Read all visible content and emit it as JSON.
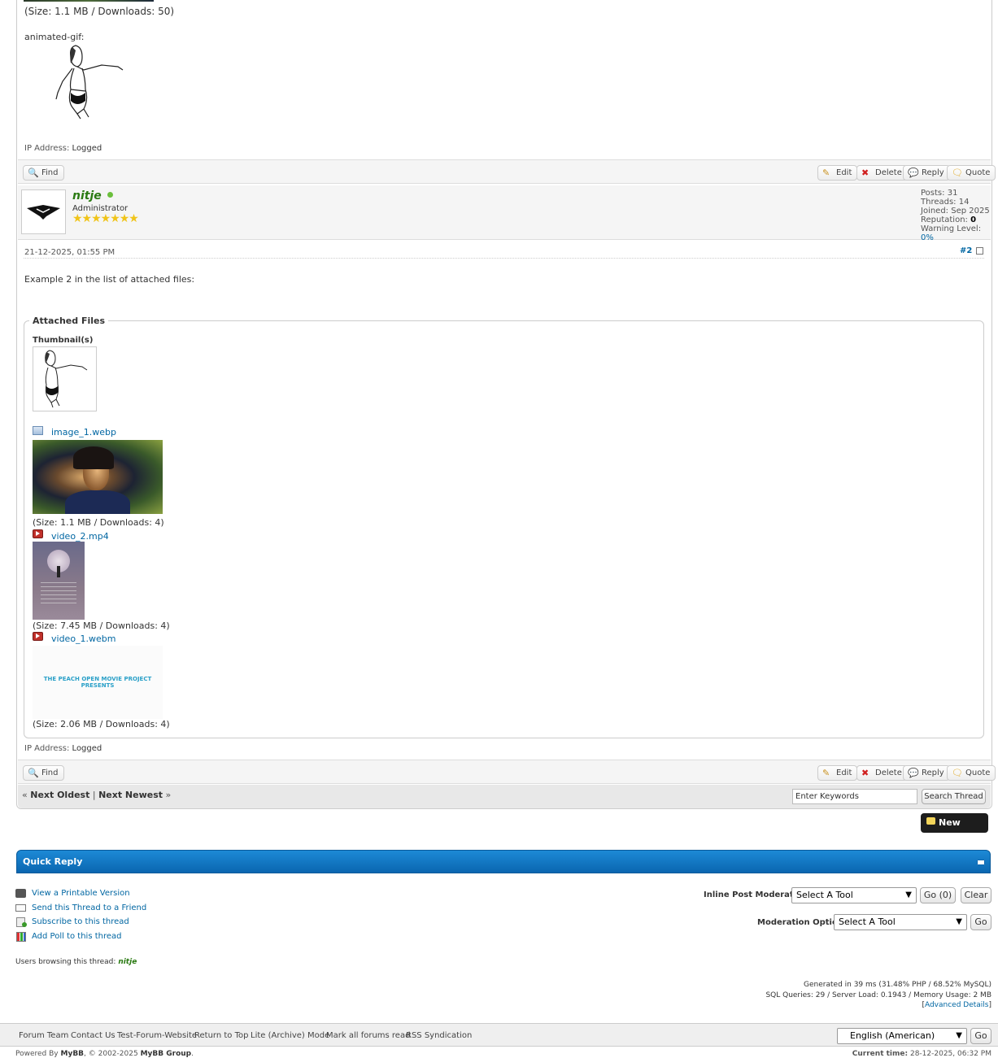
{
  "post1": {
    "size_text": "(Size: 1.1 MB / Downloads: 50)",
    "gif_label": "animated-gif:",
    "ip_label": "IP Address:",
    "ip_value": "Logged",
    "find": "Find",
    "edit": "Edit",
    "delete": "Delete",
    "reply": "Reply",
    "quote": "Quote"
  },
  "post2": {
    "username": "nitje",
    "role": "Administrator",
    "stars": "★★★★★★★",
    "stats": {
      "posts_label": "Posts:",
      "posts": "31",
      "threads_label": "Threads:",
      "threads": "14",
      "joined_label": "Joined:",
      "joined": "Sep 2025",
      "rep_label": "Reputation:",
      "rep": "0",
      "warn_label": "Warning Level:",
      "warn": "0%"
    },
    "date": "21-12-2025, 01:55 PM",
    "post_number": "#2",
    "body": "Example 2 in the list of attached files:",
    "attachments": {
      "legend": "Attached Files",
      "thumbnails_label": "Thumbnail(s)",
      "files": [
        {
          "name": "image_1.webp",
          "size": "(Size: 1.1 MB / Downloads: 4)"
        },
        {
          "name": "video_2.mp4",
          "size": "(Size: 7.45 MB / Downloads: 4)"
        },
        {
          "name": "video_1.webm",
          "size": "(Size: 2.06 MB / Downloads: 4)"
        }
      ],
      "peach_text": "THE PEACH OPEN MOVIE PROJECT PRESENTS"
    },
    "ip_label": "IP Address:",
    "ip_value": "Logged",
    "find": "Find",
    "edit": "Edit",
    "delete": "Delete",
    "reply": "Reply",
    "quote": "Quote"
  },
  "nav": {
    "prev_arrow": "«",
    "next_oldest": "Next Oldest",
    "separator": "|",
    "next_newest": "Next Newest",
    "next_arrow": "»",
    "search_placeholder": "Enter Keywords",
    "search_button": "Search Thread"
  },
  "new_reply": "New Reply",
  "quick_reply": "Quick Reply",
  "tools": {
    "printable": "View a Printable Version",
    "send_friend": "Send this Thread to a Friend",
    "subscribe": "Subscribe to this thread",
    "add_poll": "Add Poll to this thread"
  },
  "moderation": {
    "inline_label": "Inline Post Moderation:",
    "inline_select": "Select A Tool",
    "go_count": "Go (0)",
    "clear": "Clear",
    "options_label": "Moderation Options:",
    "options_select": "Select A Tool",
    "go": "Go"
  },
  "browsing": {
    "label": "Users browsing this thread:",
    "user": "nitje"
  },
  "debug": {
    "line1": "Generated in 39 ms (31.48% PHP / 68.52% MySQL)",
    "line2": "SQL Queries: 29 / Server Load: 0.1943 / Memory Usage: 2 MB",
    "bracket_open": "[",
    "advanced": "Advanced Details",
    "bracket_close": "]"
  },
  "footer": {
    "links": [
      "Forum Team",
      "Contact Us",
      "Test-Forum-Website",
      "Return to Top",
      "Lite (Archive) Mode",
      "Mark all forums read",
      "RSS Syndication"
    ],
    "language": "English (American)",
    "go": "Go"
  },
  "copyright": {
    "powered": "Powered By",
    "mybb": "MyBB",
    "rest": ", © 2002-2025",
    "group": "MyBB Group",
    "dot": "."
  },
  "current_time": {
    "label": "Current time:",
    "value": "28-12-2025, 06:32 PM"
  },
  "colors": {
    "accent_blue": "#0f76c2",
    "online_green": "#6bbf3c",
    "username_green": "#2a7a12"
  }
}
